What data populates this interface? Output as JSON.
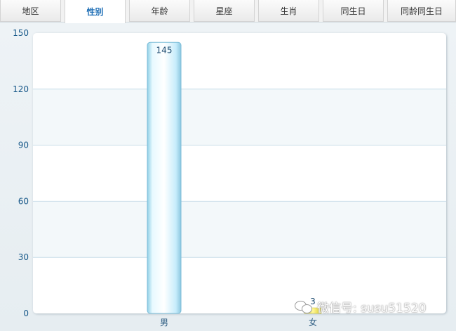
{
  "tabs": [
    {
      "label": "地区",
      "active": false
    },
    {
      "label": "性别",
      "active": true
    },
    {
      "label": "年龄",
      "active": false
    },
    {
      "label": "星座",
      "active": false
    },
    {
      "label": "生肖",
      "active": false
    },
    {
      "label": "同生日",
      "active": false
    },
    {
      "label": "同龄同生日",
      "active": false
    }
  ],
  "colors": {
    "accent": "#1f6fb6",
    "bar_male": "#cdefff",
    "bar_female": "#f3ea6a",
    "gridline": "#c9dde9"
  },
  "chart_data": {
    "type": "bar",
    "categories": [
      "男",
      "女"
    ],
    "values": [
      145,
      3
    ],
    "data_labels": [
      "145",
      "3"
    ],
    "ylim": [
      0,
      150
    ],
    "yticks": [
      0,
      30,
      60,
      90,
      120,
      150
    ],
    "title": "",
    "xlabel": "",
    "ylabel": "",
    "grid": true
  },
  "watermark": {
    "text": "微信号: susu51520",
    "icon": "wechat-icon"
  }
}
